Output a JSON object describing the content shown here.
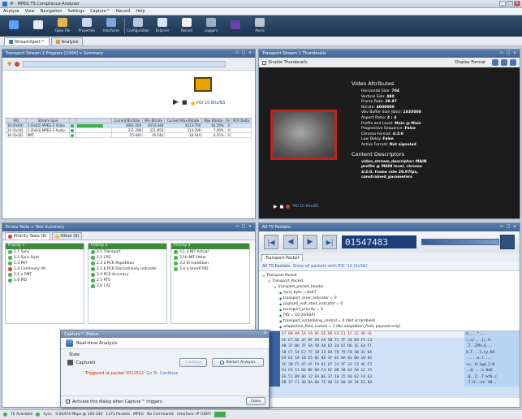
{
  "window": {
    "title": "IP - MPEG TS Compliance Analyzer",
    "controls": [
      "_",
      "□",
      "x"
    ]
  },
  "menu": [
    "Analyze",
    "View",
    "Navigation",
    "Settings",
    "Capture™",
    "Record",
    "Help"
  ],
  "toolbar": [
    {
      "label": "",
      "icon": "app-logo-icon",
      "color": "#5aa0ff"
    },
    {
      "label": "",
      "icon": "play-icon",
      "color": "#dfe9f6"
    },
    {
      "label": "Open File",
      "icon": "open-file-icon",
      "color": "#e7b84a"
    },
    {
      "label": "Properties",
      "icon": "properties-icon",
      "color": "#c9d8ea"
    },
    {
      "label": "Interfaces",
      "icon": "interfaces-icon",
      "color": "#7fa7d6"
    },
    {
      "label": "",
      "icon": "separator",
      "color": ""
    },
    {
      "label": "Configuration",
      "icon": "configuration-icon",
      "color": "#b7c6da"
    },
    {
      "label": "Explorer",
      "icon": "explorer-icon",
      "color": "#d8e5f4"
    },
    {
      "label": "Record",
      "icon": "record-icon",
      "color": "#f0f0f0"
    },
    {
      "label": "Loggers",
      "icon": "loggers-icon",
      "color": "#9bb0c8"
    },
    {
      "label": "",
      "icon": "counter-icon",
      "color": "#6c3fb0"
    },
    {
      "label": "Alerts",
      "icon": "alerts-icon",
      "color": "#b9c4d2"
    }
  ],
  "tabs": [
    {
      "label": "StreamXpert™"
    },
    {
      "label": "Analysis"
    }
  ],
  "program_panel": {
    "header": "Transport Stream 1 Program [1004] > Summary",
    "play_label": "PID 10 Bits/BS",
    "columns": [
      "PID",
      "Stream type",
      "",
      "",
      "Current Bit Rate",
      "Min Bitrate",
      "Current Max Bitrate",
      "Max Bitrate",
      "%",
      "PCR Delta"
    ],
    "rows": [
      {
        "pid": "10 (0x0A)",
        "type": "2 (0x02) MPEG-2 Video",
        "cur": "3901-209",
        "min": "4014-448",
        "cmax": "4213-704",
        "max": "92.59%",
        "pct": "0",
        "sel": true,
        "bar": 0.78
      },
      {
        "pid": "20 (0x14)",
        "type": "3 (0x03) MPEG-1 Audio",
        "cur": "311-298",
        "min": "311-850",
        "cmax": "314-296",
        "max": "7.09%",
        "pct": "0",
        "sel": false,
        "bar": 0
      },
      {
        "pid": "30 (0x1E)",
        "type": "PMT",
        "cur": "25-040",
        "min": "16-544",
        "cmax": "16-544",
        "max": "0.35%",
        "pct": "0",
        "sel": false,
        "bar": 0
      }
    ]
  },
  "thumbnail_panel": {
    "header": "Transport Stream 1 Thumbnails",
    "enable_label": "Enable Thumbnails",
    "display_format": "Display Format",
    "video_title": "Video Attributes",
    "attributes": [
      {
        "k": "Horizontal Size:",
        "v": "704"
      },
      {
        "k": "Vertical Size:",
        "v": "480"
      },
      {
        "k": "Frame Rate:",
        "v": "29.97"
      },
      {
        "k": "Bitrate:",
        "v": "4000000"
      },
      {
        "k": "Vbv Buffer Size (bits):",
        "v": "1835008"
      },
      {
        "k": "Aspect Ratio:",
        "v": "4 : 4"
      },
      {
        "k": "Profile and Level:",
        "v": "Main @ Main"
      },
      {
        "k": "Progressive Sequence:",
        "v": "False"
      },
      {
        "k": "Chroma Format:",
        "v": "4:2:0"
      },
      {
        "k": "Low Delay:",
        "v": "False"
      },
      {
        "k": "Active Format:",
        "v": "Not signaled"
      }
    ],
    "content_title": "Content Descriptors",
    "content_lines": [
      "video_stream_descriptor: MAIN",
      "profile @ MAIN level, chroma",
      "4:2:0, frame rate 29.97fps,",
      "constrained_parameters"
    ],
    "pid_label": "PID 10 Bits/BS"
  },
  "tests_panel": {
    "header": "Errata Tests > Test Summary",
    "subtabs": [
      "Priority Tests (6)",
      "Other (9)"
    ],
    "columns": [
      {
        "title": "Priority 1",
        "items": [
          {
            "label": "1.1 Sync",
            "status": "g"
          },
          {
            "label": "1.2 Sync Byte",
            "status": "g"
          },
          {
            "label": "1.3 PAT",
            "status": "g"
          },
          {
            "label": "1.4 Continuity (9)",
            "status": "r"
          },
          {
            "label": "1.5 a PMT",
            "status": "g"
          },
          {
            "label": "1.6 PID",
            "status": "g"
          }
        ]
      },
      {
        "title": "Priority 2",
        "items": [
          {
            "label": "2.1 Transport",
            "status": "g"
          },
          {
            "label": "2.2 CRC",
            "status": "g"
          },
          {
            "label": "2.3 a PCR Repetition",
            "status": "g"
          },
          {
            "label": "2.3 b PCR Discontinuity Indicator",
            "status": "g"
          },
          {
            "label": "2.4 PCR Accuracy",
            "status": "g"
          },
          {
            "label": "2.5 PTS",
            "status": "g"
          },
          {
            "label": "2.6 CAT",
            "status": "g"
          }
        ]
      },
      {
        "title": "Priority 3",
        "items": [
          {
            "label": "3.1 a NIT Actual",
            "status": "g"
          },
          {
            "label": "3.1b NIT Other",
            "status": "g"
          },
          {
            "label": "3.2 SI repetition",
            "status": "g"
          },
          {
            "label": "3.4 a Unreff PID",
            "status": "g"
          }
        ]
      }
    ]
  },
  "dialog": {
    "title": "Capture™ Status",
    "heading": "Real-time Analysis",
    "state_label": "State",
    "captured_label": "Captured",
    "trigger_label": "Triggered at packet 2011512",
    "trigger_link": "Go To",
    "continue_link": "Continue",
    "disabled_btn": "Continue",
    "restart_btn": "Restart Analysis",
    "checkbox_label": "Activate this dialog when Capture™ triggers",
    "close_btn": "Close"
  },
  "packets_panel": {
    "header": "All TS Packets",
    "packet_number": "01547483",
    "subtab": "Transport Packet",
    "filter_label": "All TS Packets",
    "filter_link": "Show all packets with PID '10 (0x0A)'",
    "tree": [
      {
        "text": "Transport Packet",
        "indent": 0
      },
      {
        "text": "Transport_Packet",
        "indent": 1
      },
      {
        "text": "transport_packet_header",
        "indent": 2
      },
      {
        "text": "sync_byte = 0x47",
        "indent": 3
      },
      {
        "text": "transport_error_indicator = 0",
        "indent": 3
      },
      {
        "text": "payload_unit_start_indicator = 0",
        "indent": 3
      },
      {
        "text": "transport_priority = 0",
        "indent": 3
      },
      {
        "text": "PID = 10 (0x00A)",
        "indent": 3
      },
      {
        "text": "transport_scrambling_control = 0 (Not scrambled)",
        "indent": 3
      },
      {
        "text": "adaptation_field_control = 1 (No adaptation_field, payload only)",
        "indent": 3
      }
    ],
    "hex_rows": [
      {
        "a": "0000",
        "h": "47 00 0A 1A 1A 01 5E 09 E4 E1 1F 1C AD 3E",
        "s": "G....^..."
      },
      {
        "a": "0010",
        "h": "5C E7 6E 2F 8F C6 AA 5B 7C 7F 34 B3 F5 C4",
        "s": "\\.n/...[|.4."
      },
      {
        "a": "0020",
        "h": "AB 37 B6 7F 5A 59 48 D3 34 07 D6 1E E4 FT",
        "s": ".7..ZYH.4..."
      },
      {
        "a": "0030",
        "h": "58 C7 54 E2 7F 1B 33 D8 7D 79 F8 4B 41 DA",
        "s": "X.T...3.}y.KA"
      },
      {
        "a": "0040",
        "h": "E9 E4 1A 18 E5 6E 8E 3F 82 0A 03 BD 10 05",
        "s": ".....n.?...."
      },
      {
        "a": "0050",
        "h": "3C 2B F5 07 4F F9 6C 67 24 5F 32 C2 4E F2",
        "s": "<+..O.lg$_2.N"
      },
      {
        "a": "0060",
        "h": "91 FO 51 DA BE D9 F4 6F 0B 38 64 5A 12 C5",
        "s": "..Q....o.8dZ."
      },
      {
        "a": "0070",
        "h": "EA 51 B9 86 32 EA 0E 37 18 25 66 62 FA 63",
        "s": ".Q..2..7.%fb.c"
      },
      {
        "a": "0080",
        "h": "EB 37 C1 48 DA DA 7E 48 3A 60 39 34 E3 B4",
        "s": ".7.H..~H:`94.."
      }
    ]
  },
  "status": {
    "items": [
      "TS Available",
      "Sync",
      "5.00474 Mbps @ 100.140",
      "1371 Packets",
      "MPEG",
      "No Commands",
      "Interface: IP [UDP]"
    ]
  }
}
